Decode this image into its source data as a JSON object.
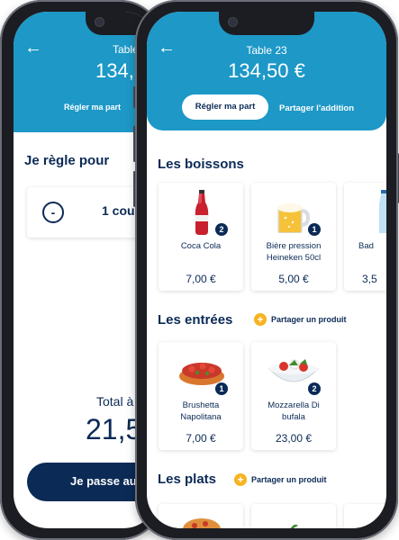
{
  "back_phone": {
    "title": "Table",
    "amount": "134,5",
    "tab_active": "Régler ma part",
    "section_title": "Je règle pour",
    "stepper_text": "1 cou",
    "total_label": "Total à",
    "total_amount": "21,5",
    "cta_label": "Je passe au"
  },
  "front_phone": {
    "title": "Table 23",
    "amount": "134,50 €",
    "tabs": [
      {
        "label": "Régler ma part"
      },
      {
        "label": "Partager l'addition"
      }
    ],
    "sections": {
      "boissons": {
        "title": "Les boissons"
      },
      "entrees": {
        "title": "Les entrées",
        "share_label": "Partager un produit"
      },
      "plats": {
        "title": "Les plats",
        "share_label": "Partager un produit"
      }
    },
    "drinks": [
      {
        "name": "Coca Cola",
        "price": "7,00 €",
        "badge": "2",
        "icon": "coca-cola-bottle-icon"
      },
      {
        "name": "Bière pression Heineken 50cl",
        "price": "5,00 €",
        "badge": "1",
        "icon": "beer-mug-icon"
      },
      {
        "name": "Bad",
        "price": "3,5",
        "icon": "water-bottle-icon"
      }
    ],
    "starters": [
      {
        "name": "Brushetta Napolitana",
        "price": "7,00 €",
        "badge": "1",
        "icon": "bruschetta-icon"
      },
      {
        "name": "Mozzarella Di bufala",
        "price": "23,00 €",
        "badge": "2",
        "icon": "mozzarella-salad-icon"
      }
    ]
  },
  "colors": {
    "header": "#1d98c7",
    "navy": "#0b2a56",
    "accent": "#f7b321"
  }
}
